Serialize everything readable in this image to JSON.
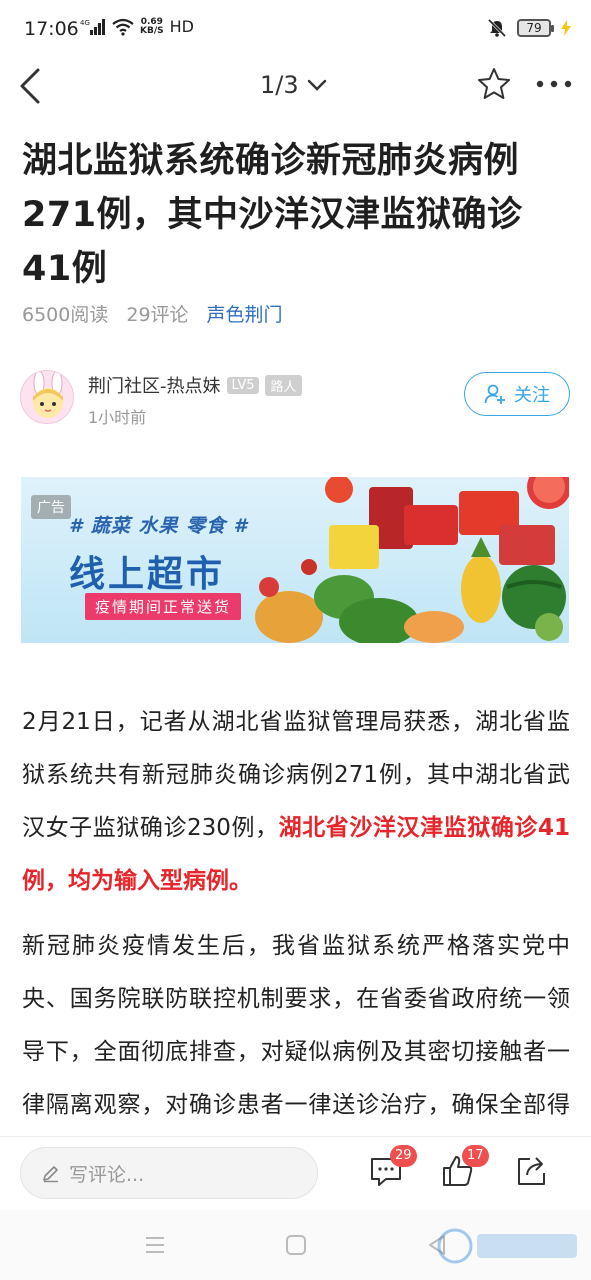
{
  "status_bar": {
    "time": "17:06",
    "network": "4G",
    "speed_value": "0.69",
    "speed_unit": "KB/S",
    "hd": "HD",
    "battery": "79"
  },
  "nav": {
    "page_indicator": "1/3",
    "icons": [
      "back-arrow-icon",
      "chevron-down-icon",
      "star-icon",
      "more-icon"
    ]
  },
  "article": {
    "title": "湖北监狱系统确诊新冠肺炎病例271例，其中沙洋汉津监狱确诊41例",
    "reads": "6500阅读",
    "comments": "29评论",
    "source": "声色荆门"
  },
  "author": {
    "name": "荆门社区-热点妹",
    "level": "LV5",
    "rank": "路人",
    "time": "1小时前",
    "follow_label": "关注"
  },
  "ad": {
    "label": "广告",
    "tags": "# 蔬菜 水果 零食 #",
    "title": "线上超市",
    "subtitle": "疫情期间正常送货"
  },
  "body": {
    "p1_normal": "2月21日，记者从湖北省监狱管理局获悉，湖北省监狱系统共有新冠肺炎确诊病例271例，其中湖北省武汉女子监狱确诊230例，",
    "p1_highlight": "湖北省沙洋汉津监狱确诊41例，均为输入型病例。",
    "p2": "新冠肺炎疫情发生后，我省监狱系统严格落实党中央、国务院联防联控机制要求，在省委省政府统一领导下，全面彻底排查，对疑似病例及其密切接触者一律隔离观察，对确诊患者一律送诊治疗，确保全部得到及时救治。目前"
  },
  "bottom_bar": {
    "comment_placeholder": "写评论...",
    "comment_count": "29",
    "like_count": "17"
  },
  "colors": {
    "accent": "#3aa7e8",
    "highlight": "#e8252a",
    "source": "#2f6fbf",
    "badge": "#ef4f4f"
  }
}
